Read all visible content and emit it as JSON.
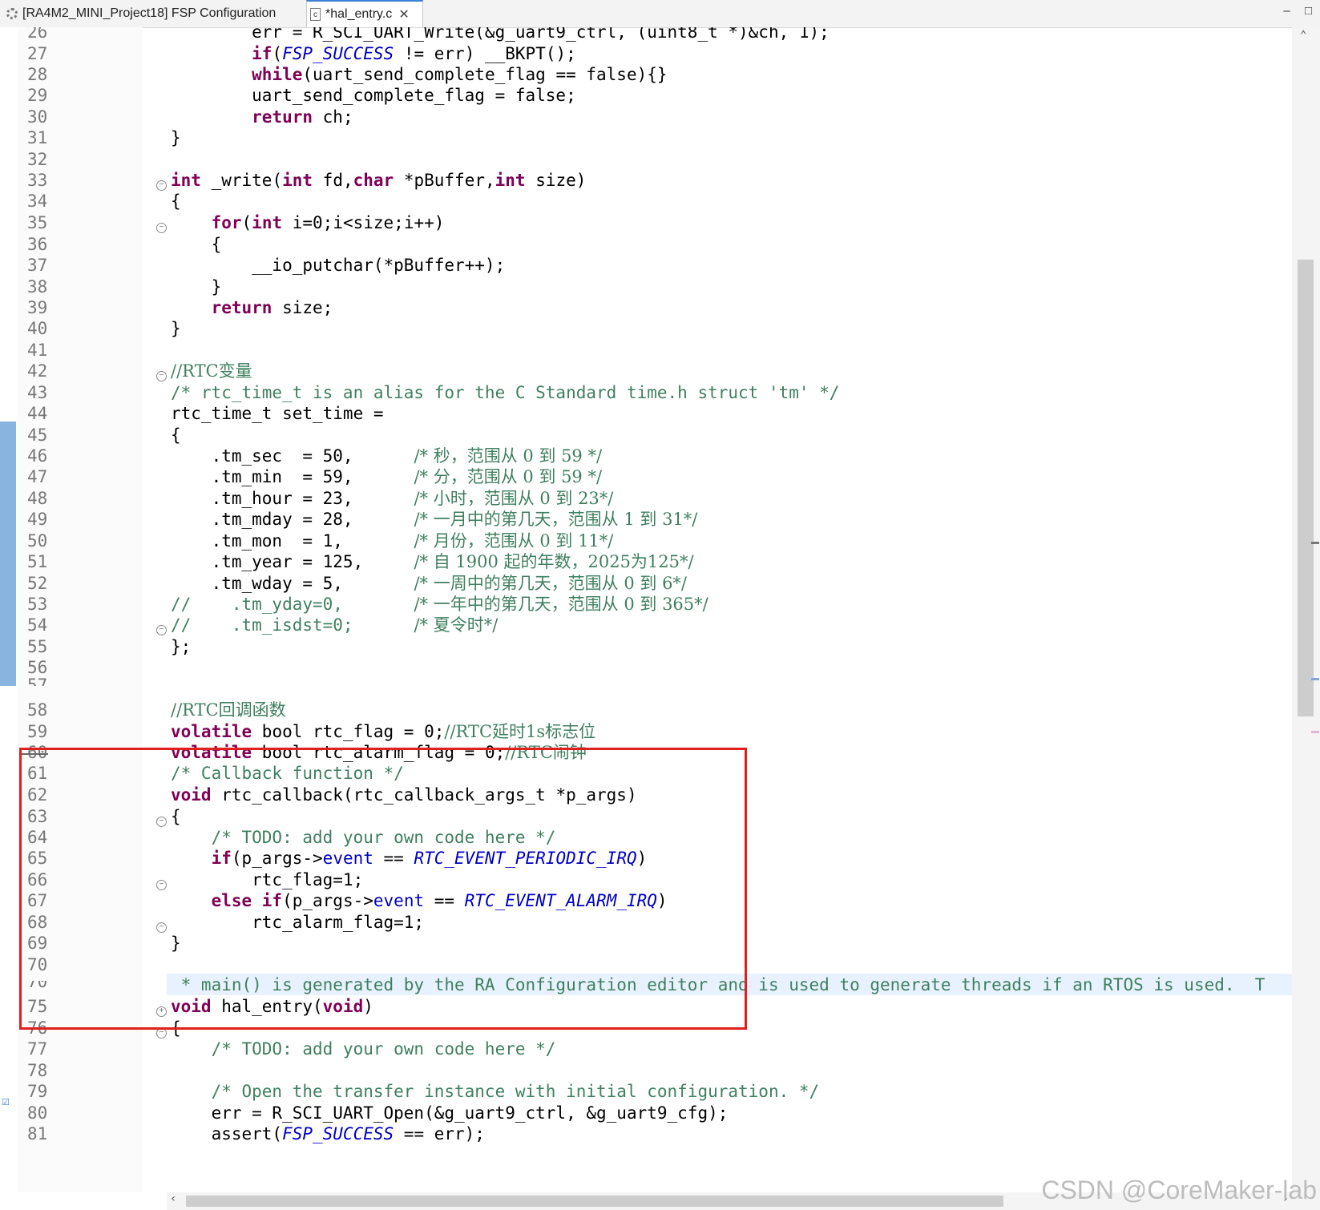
{
  "tabs": [
    {
      "title": "[RA4M2_MINI_Project18] FSP Configuration",
      "icon": "gear-icon"
    },
    {
      "title": "*hal_entry.c",
      "icon": "c-file-icon",
      "close": "✕"
    }
  ],
  "window_controls": {
    "minimize": "–",
    "maximize": "□"
  },
  "line_numbers": [
    "26",
    "27",
    "28",
    "29",
    "30",
    "31",
    "32",
    "33",
    "34",
    "35",
    "36",
    "37",
    "38",
    "39",
    "40",
    "41",
    "42",
    "43",
    "44",
    "45",
    "46",
    "47",
    "48",
    "49",
    "50",
    "51",
    "52",
    "53",
    "54",
    "55",
    "56",
    "57",
    "58",
    "59",
    "60",
    "61",
    "62",
    "63",
    "64",
    "65",
    "66",
    "67",
    "68",
    "69",
    "70",
    "72",
    "75",
    "76",
    "77",
    "78",
    "79",
    "80",
    "81"
  ],
  "code": {
    "l26": {
      "a": "        err = R_SCI_UART_Write(&g_uart9_ctrl, (uint8_t *)&ch, 1);"
    },
    "l27": {
      "a": "if",
      "b": "(",
      "c": "FSP_SUCCESS",
      "d": " != err) __BKPT();"
    },
    "l28": {
      "a": "while",
      "b": "(uart_send_complete_flag == false){}"
    },
    "l29": {
      "a": "        uart_send_complete_flag = false;"
    },
    "l30": {
      "a": "return",
      "b": " ch;"
    },
    "l31": {
      "a": "}"
    },
    "l33": {
      "a": "int",
      "b": " _write(",
      "c": "int",
      "d": " fd,",
      "e": "char",
      "f": " *pBuffer,",
      "g": "int",
      "h": " size)"
    },
    "l34": {
      "a": "{"
    },
    "l35": {
      "a": "for",
      "b": "(",
      "c": "int",
      "d": " i=0;i<size;i++)"
    },
    "l36": {
      "a": "    {"
    },
    "l37": {
      "a": "        __io_putchar(*pBuffer++);"
    },
    "l38": {
      "a": "    }"
    },
    "l39": {
      "a": "return",
      "b": " size;"
    },
    "l40": {
      "a": "}"
    },
    "l42": {
      "a": "//RTC变量"
    },
    "l43": {
      "a": "/* rtc_time_t is an alias for the C Standard time.h struct 'tm' */"
    },
    "l44": {
      "a": "rtc_time_t set_time ="
    },
    "l45": {
      "a": "{"
    },
    "l46": {
      "a": "    .tm_sec  = 50,      ",
      "b": "/* 秒，范围从 0 到 59 */"
    },
    "l47": {
      "a": "    .tm_min  = 59,      ",
      "b": "/* 分，范围从 0 到 59 */"
    },
    "l48": {
      "a": "    .tm_hour = 23,      ",
      "b": "/* 小时，范围从 0 到 23*/"
    },
    "l49": {
      "a": "    .tm_mday = 28,      ",
      "b": "/* 一月中的第几天，范围从 1 到 31*/"
    },
    "l50": {
      "a": "    .tm_mon  = 1,       ",
      "b": "/* 月份，范围从 0 到 11*/"
    },
    "l51": {
      "a": "    .tm_year = 125,     ",
      "b": "/* 自 1900 起的年数，2025为125*/"
    },
    "l52": {
      "a": "    .tm_wday = 5,       ",
      "b": "/* 一周中的第几天，范围从 0 到 6*/"
    },
    "l53": {
      "a": "//    .tm_yday=0,       ",
      "b": "/* 一年中的第几天，范围从 0 到 365*/"
    },
    "l54": {
      "a": "//    .tm_isdst=0;      ",
      "b": "/* 夏令时*/"
    },
    "l55": {
      "a": "};"
    },
    "l58": {
      "a": "//RTC回调函数"
    },
    "l59": {
      "a": "volatile",
      "b": " bool rtc_flag = 0;",
      "c": "//RTC延时1s标志位"
    },
    "l60": {
      "a": "volatile",
      "b": " bool rtc_alarm_flag = 0;",
      "c": "//RTC闹钟"
    },
    "l61": {
      "a": "/* Callback function */"
    },
    "l62": {
      "a": "void",
      "b": " rtc_callback(rtc_callback_args_t *p_args)"
    },
    "l63": {
      "a": "{"
    },
    "l64": {
      "a": "    /* TODO: add your own code here */"
    },
    "l65": {
      "a": "if",
      "b": "(p_args->",
      "c": "event",
      "d": " == ",
      "e": "RTC_EVENT_PERIODIC_IRQ",
      "f": ")"
    },
    "l66": {
      "a": "        rtc_flag=1;"
    },
    "l67": {
      "a": "else if",
      "b": "(p_args->",
      "c": "event",
      "d": " == ",
      "e": "RTC_EVENT_ALARM_IRQ",
      "f": ")"
    },
    "l68": {
      "a": "        rtc_alarm_flag=1;"
    },
    "l69": {
      "a": "}"
    },
    "l72": {
      "a": " * main() is generated by the RA Configuration editor and is used to generate threads if an RTOS is used.  T"
    },
    "l75": {
      "a": "void",
      "b": " hal_entry(",
      "c": "void",
      "d": ")"
    },
    "l76": {
      "a": "{"
    },
    "l77": {
      "a": "    /* TODO: add your own code here */"
    },
    "l79": {
      "a": "    /* Open the transfer instance with initial configuration. */"
    },
    "l80": {
      "a": "    err = R_SCI_UART_Open(&g_uart9_ctrl, &g_uart9_cfg);"
    },
    "l81": {
      "a": "    assert(",
      "b": "FSP_SUCCESS",
      "c": " == err);"
    }
  },
  "colors": {
    "keyword": "#7f0055",
    "comment": "#3f7f5f",
    "macro": "#0000c0",
    "highlight_box": "#e02020",
    "current_line": "#e8f2fe"
  },
  "watermark": "CSDN @CoreMaker-lab"
}
